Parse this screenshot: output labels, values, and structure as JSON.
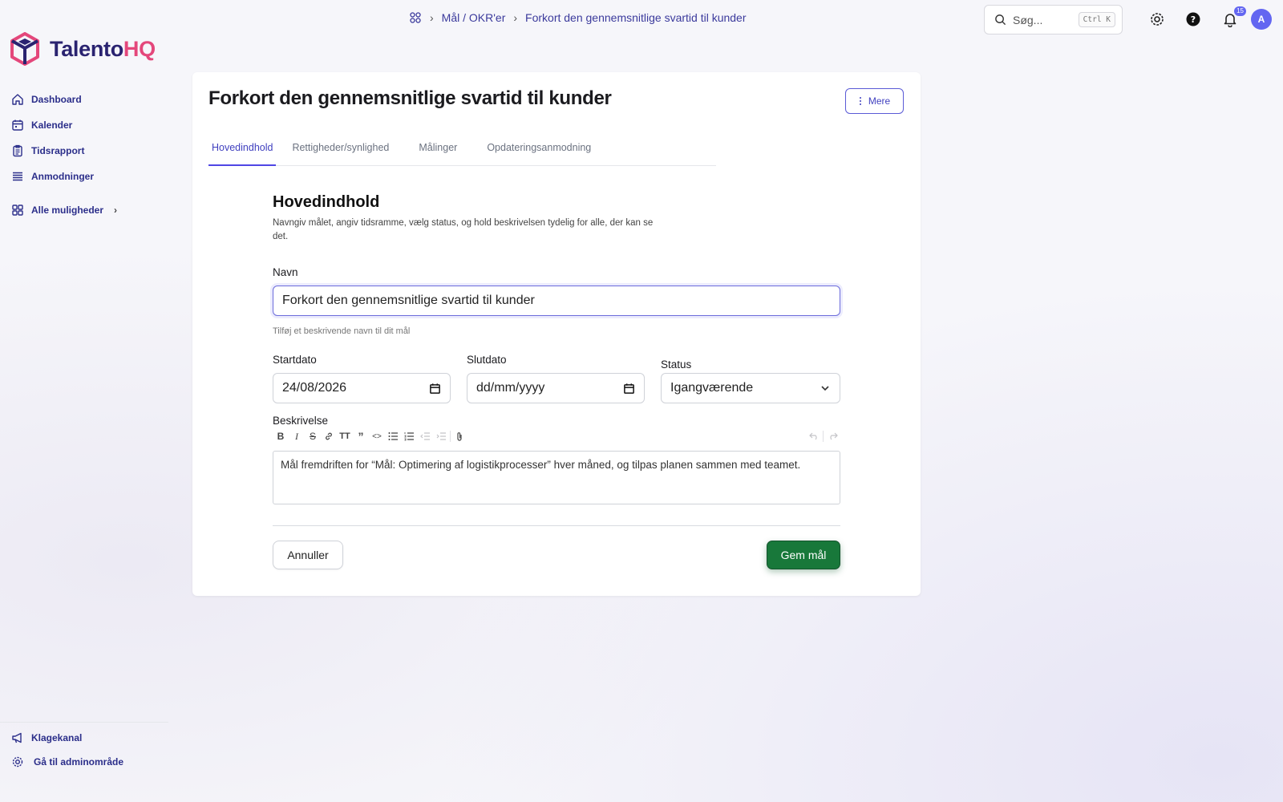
{
  "app": {
    "logo_part1": "Talento",
    "logo_part2": "HQ"
  },
  "sidebar": {
    "items": [
      {
        "label": "Dashboard",
        "icon": "home-icon"
      },
      {
        "label": "Kalender",
        "icon": "calendar-icon"
      },
      {
        "label": "Tidsrapport",
        "icon": "clipboard-icon"
      },
      {
        "label": "Anmodninger",
        "icon": "stack-icon"
      }
    ],
    "all_label": "Alle muligheder",
    "bottom": [
      {
        "label": "Klagekanal",
        "icon": "megaphone-icon"
      },
      {
        "label": "Gå til adminområde",
        "icon": "gear-icon"
      }
    ]
  },
  "breadcrumb": {
    "section": "Mål / OKR'er",
    "current": "Forkort den gennemsnitlige svartid til kunder"
  },
  "search": {
    "placeholder": "Søg...",
    "shortcut": "Ctrl K"
  },
  "notifications": {
    "count": "15"
  },
  "user": {
    "initial": "A"
  },
  "page": {
    "title": "Forkort den gennemsnitlige svartid til kunder",
    "more_label": "Mere",
    "tabs": [
      "Hovedindhold",
      "Rettigheder/synlighed",
      "Målinger",
      "Opdateringsanmodning"
    ],
    "active_tab": "Hovedindhold"
  },
  "form": {
    "section_title": "Hovedindhold",
    "section_desc": "Navngiv målet, angiv tidsramme, vælg status, og hold beskrivelsen tydelig for alle, der kan se det.",
    "name_label": "Navn",
    "name_value": "Forkort den gennemsnitlige svartid til kunder",
    "name_hint": "Tilføj et beskrivende navn til dit mål",
    "start_label": "Startdato",
    "start_value": "24/08/2026",
    "end_label": "Slutdato",
    "end_placeholder": "dd/mm/yyyy",
    "status_label": "Status",
    "status_value": "Igangværende",
    "desc_label": "Beskrivelse",
    "desc_value": "Mål fremdriften for “Mål: Optimering af logistikprocesser” hver måned, og tilpas planen sammen med teamet.",
    "cancel_label": "Annuller",
    "save_label": "Gem mål"
  },
  "colors": {
    "accent": "#4f46e5",
    "brand_pink": "#e4477b",
    "save_green": "#18783a"
  }
}
